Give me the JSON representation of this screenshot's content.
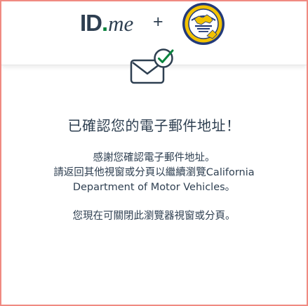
{
  "header": {
    "idme_logo_id": "ID",
    "idme_logo_dot": ".",
    "idme_logo_me": "me",
    "plus": "+"
  },
  "main": {
    "icon": "envelope-check-icon",
    "title": "已確認您的電子郵件地址！",
    "thanks": "感謝您確認電子郵件地址。",
    "return_line": "請返回其他視窗或分頁以繼續瀏覽California",
    "department_line": "Department of Motor Vehicles。",
    "close_line": "您現在可關閉此瀏覽器視窗或分頁。"
  },
  "colors": {
    "border": "#f08a82",
    "text": "#2e3f51",
    "idme_green": "#08833d",
    "check_green": "#08833d",
    "seal_gold": "#f2c200",
    "seal_blue": "#233a7a"
  }
}
